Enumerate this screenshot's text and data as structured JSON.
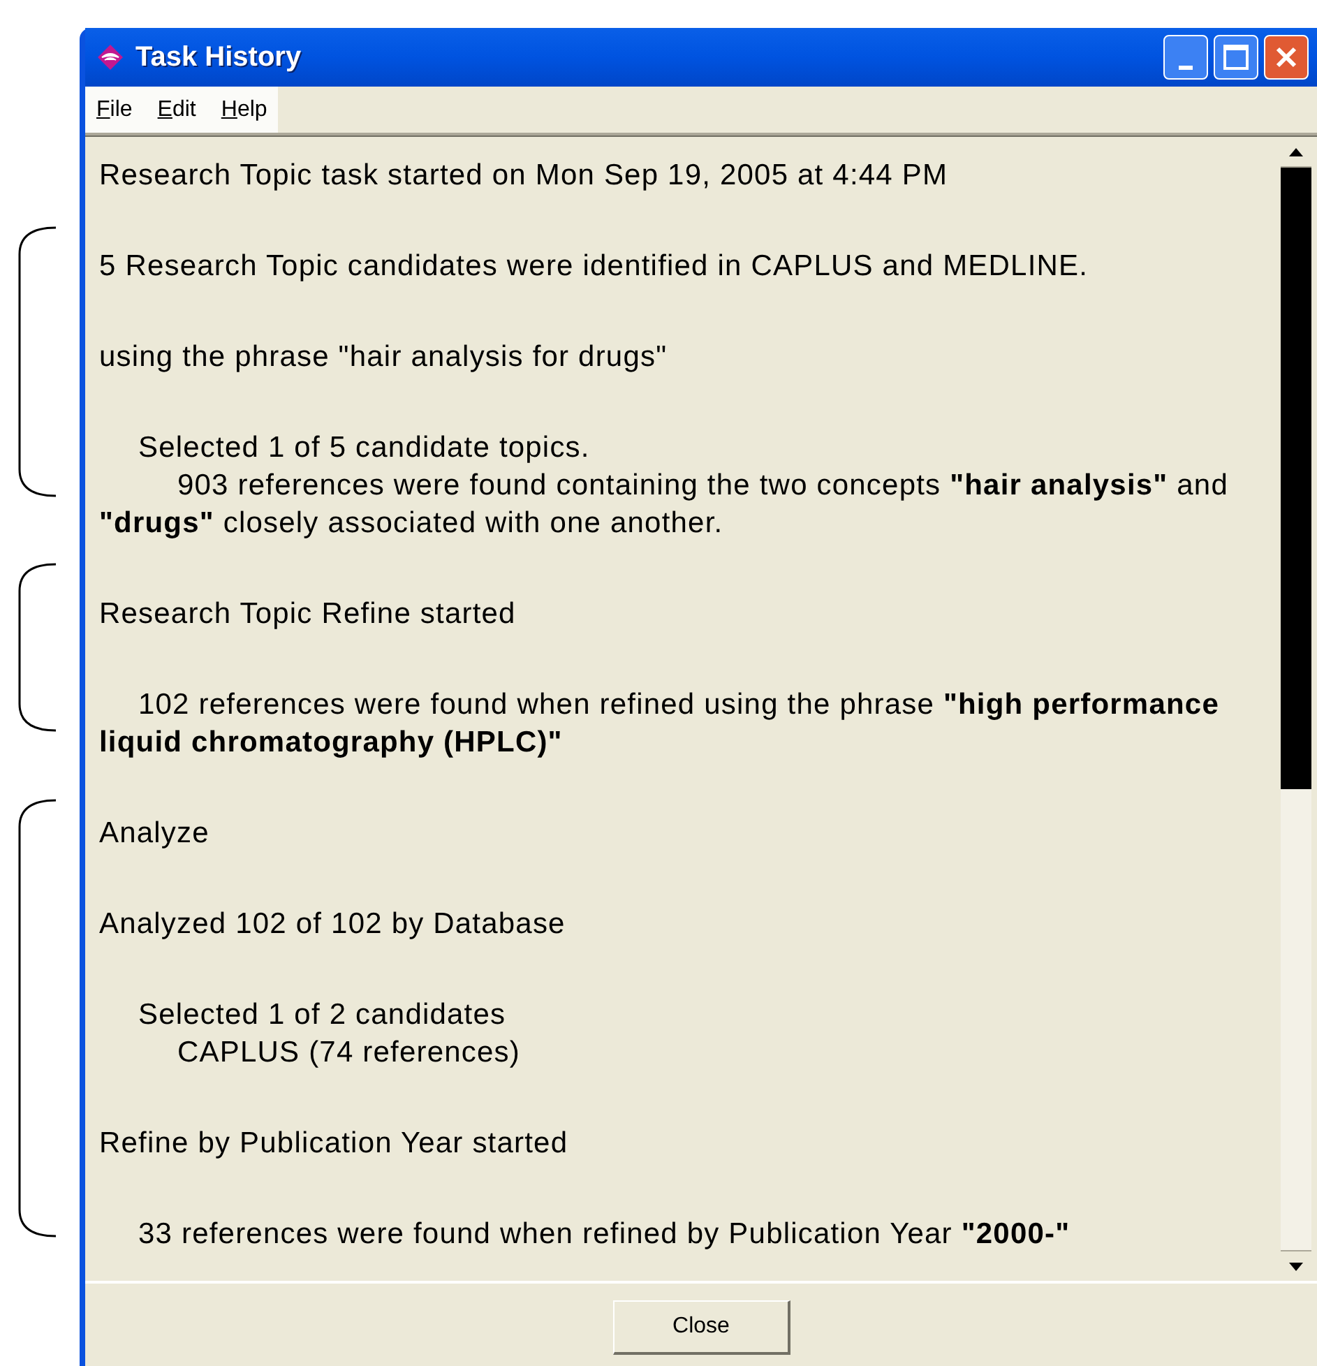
{
  "window": {
    "title": "Task History"
  },
  "menu": [
    {
      "label": "File"
    },
    {
      "label": "Edit"
    },
    {
      "label": "Help"
    }
  ],
  "blocks": [
    {
      "lines": [
        {
          "kind": "plain",
          "text": "Research Topic task started on Mon Sep 19, 2005 at 4:44 PM"
        }
      ]
    },
    {
      "lines": [
        {
          "kind": "plain",
          "text": "5 Research Topic candidates were identified in CAPLUS and MEDLINE."
        }
      ]
    },
    {
      "lines": [
        {
          "kind": "plain",
          "text": "using the phrase \"hair analysis for drugs\""
        }
      ]
    },
    {
      "lines": [
        {
          "kind": "indent1",
          "text": "Selected 1 of 5 candidate topics."
        },
        {
          "kind": "indent2",
          "text": "903 references were found containing the two concepts **\"hair analysis\"** and **\"drugs\"** closely associated with one another."
        }
      ]
    },
    {
      "lines": [
        {
          "kind": "plain",
          "text": "Research Topic Refine started"
        }
      ]
    },
    {
      "lines": [
        {
          "kind": "indent1",
          "text": "102 references were found when refined using the phrase **\"high performance liquid chromatography (HPLC)\"**"
        }
      ]
    },
    {
      "lines": [
        {
          "kind": "plain",
          "text": "Analyze"
        }
      ]
    },
    {
      "lines": [
        {
          "kind": "plain",
          "text": "Analyzed 102 of 102 by Database"
        }
      ]
    },
    {
      "lines": [
        {
          "kind": "indent1",
          "text": "Selected 1 of 2 candidates"
        },
        {
          "kind": "indent2",
          "text": "CAPLUS (74 references)"
        }
      ]
    },
    {
      "lines": [
        {
          "kind": "plain",
          "text": "Refine by Publication Year started"
        }
      ]
    },
    {
      "lines": [
        {
          "kind": "indent1",
          "text": "33 references were found when refined by Publication Year **\"2000-\"**"
        }
      ]
    }
  ],
  "brackets": [
    {
      "kind": "brace"
    },
    {
      "kind": "brace"
    },
    {
      "kind": "brace"
    }
  ],
  "close_button": "Close"
}
